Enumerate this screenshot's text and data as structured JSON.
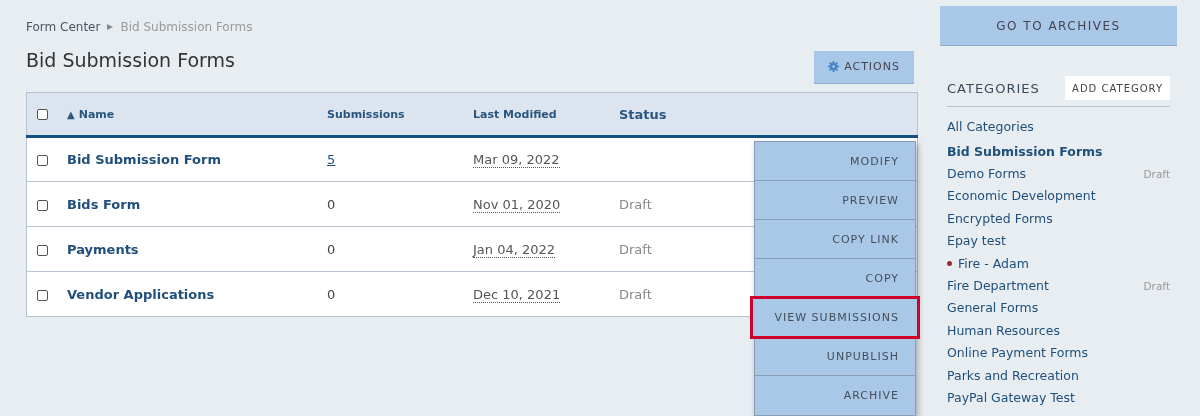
{
  "breadcrumb": {
    "items": [
      "Form Center"
    ],
    "current": "Bid Submission Forms"
  },
  "page_title": "Bid Submission Forms",
  "actions_button": "ACTIONS",
  "table": {
    "select_all_checked": false,
    "columns": [
      {
        "label": "Name",
        "sorted": true
      },
      {
        "label": "Submissions",
        "sorted": false
      },
      {
        "label": "Last Modified",
        "sorted": false
      },
      {
        "label": "Status",
        "sorted": false
      }
    ],
    "sort_arrow": "▲",
    "rows": [
      {
        "checked": false,
        "name": "Bid Submission Form",
        "submissions": "5",
        "submissions_linked": true,
        "last_modified": "Mar 09, 2022"
      },
      {
        "checked": false,
        "name": "Bids Form",
        "submissions": "0",
        "submissions_linked": false,
        "last_modified": "Nov 01, 2020",
        "status": "Draft"
      },
      {
        "checked": false,
        "name": "Payments",
        "submissions": "0",
        "submissions_linked": false,
        "last_modified": "Jan 04, 2022",
        "status": "Draft"
      },
      {
        "checked": false,
        "name": "Vendor Applications",
        "submissions": "0",
        "submissions_linked": false,
        "last_modified": "Dec 10, 2021",
        "status": "Draft"
      }
    ]
  },
  "row_menu": {
    "items": [
      {
        "label": "MODIFY",
        "selected": false
      },
      {
        "label": "PREVIEW",
        "selected": false
      },
      {
        "label": "COPY LINK",
        "selected": false
      },
      {
        "label": "COPY",
        "selected": false
      },
      {
        "label": "VIEW SUBMISSIONS",
        "selected": true
      },
      {
        "label": "UNPUBLISH",
        "selected": false
      },
      {
        "label": "ARCHIVE",
        "selected": false
      }
    ]
  },
  "sidebar": {
    "archives_button": "GO TO ARCHIVES",
    "categories_title": "CATEGORIES",
    "add_category_button": "ADD CATEGORY",
    "categories": [
      {
        "name": "All Categories",
        "selected": false,
        "marked": false
      },
      {
        "name": "Bid Submission Forms",
        "selected": true,
        "marked": false
      },
      {
        "name": "Demo Forms",
        "selected": false,
        "marked": false,
        "badge": "Draft"
      },
      {
        "name": "Economic Development",
        "selected": false,
        "marked": false
      },
      {
        "name": "Encrypted Forms",
        "selected": false,
        "marked": false
      },
      {
        "name": "Epay test",
        "selected": false,
        "marked": false
      },
      {
        "name": "Fire - Adam",
        "selected": false,
        "marked": true
      },
      {
        "name": "Fire Department",
        "selected": false,
        "marked": false,
        "badge": "Draft"
      },
      {
        "name": "General Forms",
        "selected": false,
        "marked": false
      },
      {
        "name": "Human Resources",
        "selected": false,
        "marked": false
      },
      {
        "name": "Online Payment Forms",
        "selected": false,
        "marked": false
      },
      {
        "name": "Parks and Recreation",
        "selected": false,
        "marked": false
      },
      {
        "name": "PayPal Gateway Test",
        "selected": false,
        "marked": false
      }
    ]
  }
}
